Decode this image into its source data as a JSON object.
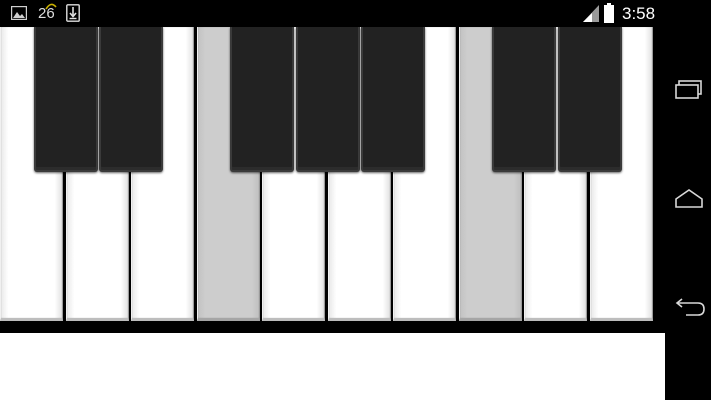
{
  "status_bar": {
    "notification_count": "26",
    "time": "3:58",
    "icons": [
      "image-icon",
      "download-icon",
      "signal-icon",
      "battery-icon"
    ]
  },
  "keyboard": {
    "white_keys": [
      {
        "pressed": false
      },
      {
        "pressed": false
      },
      {
        "pressed": false
      },
      {
        "pressed": true
      },
      {
        "pressed": false
      },
      {
        "pressed": false
      },
      {
        "pressed": false
      },
      {
        "pressed": true
      },
      {
        "pressed": false
      },
      {
        "pressed": false
      }
    ],
    "black_keys_after_white": [
      1,
      2,
      4,
      5,
      6,
      8,
      9
    ],
    "colors": {
      "white_key": "#ffffff",
      "pressed_key": "#cdcdcd",
      "black_key": "#222222",
      "background": "#000000"
    }
  },
  "nav_bar": {
    "buttons": [
      "recent-apps-icon",
      "home-icon",
      "back-icon"
    ]
  }
}
